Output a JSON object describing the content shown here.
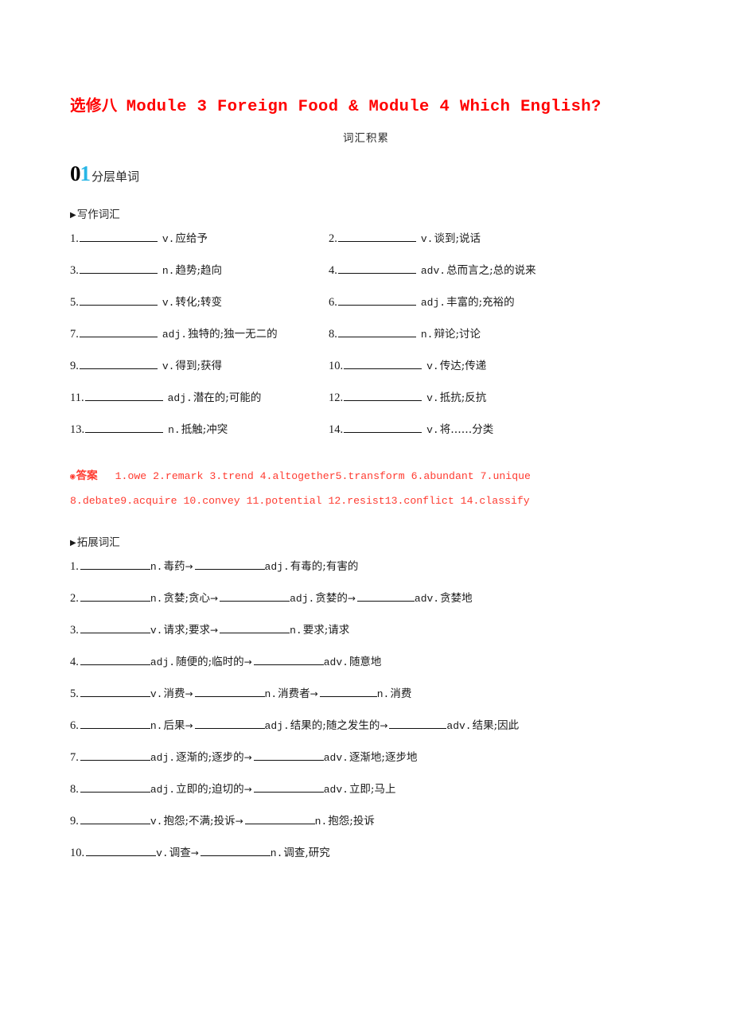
{
  "document": {
    "title_cn": "选修八",
    "title_en": "Module 3  Foreign Food & Module 4  Which English?",
    "subtitle": "词汇积累",
    "title_color": "#ff0000"
  },
  "section": {
    "number_first": "0",
    "number_second": "1",
    "label": "分层单词",
    "accent_color": "#29b6e6"
  },
  "writing_vocab": {
    "heading": "写作词汇",
    "marker": "triangle-right-icon",
    "items": [
      {
        "index": "1.",
        "pos": "v.",
        "meaning": "应给予"
      },
      {
        "index": "2.",
        "pos": "v.",
        "meaning": "谈到;说话"
      },
      {
        "index": "3.",
        "pos": "n.",
        "meaning": "趋势;趋向"
      },
      {
        "index": "4.",
        "pos": "adv.",
        "meaning": "总而言之;总的说来"
      },
      {
        "index": "5.",
        "pos": "v.",
        "meaning": "转化;转变"
      },
      {
        "index": "6.",
        "pos": "adj.",
        "meaning": "丰富的;充裕的"
      },
      {
        "index": "7.",
        "pos": "adj.",
        "meaning": "独特的;独一无二的"
      },
      {
        "index": "8.",
        "pos": "n.",
        "meaning": "辩论;讨论"
      },
      {
        "index": "9.",
        "pos": "v.",
        "meaning": "得到;获得"
      },
      {
        "index": "10.",
        "pos": "v.",
        "meaning": "传达;传递"
      },
      {
        "index": "11.",
        "pos": "adj.",
        "meaning": "潜在的;可能的"
      },
      {
        "index": "12.",
        "pos": "v.",
        "meaning": "抵抗;反抗"
      },
      {
        "index": "13.",
        "pos": "n.",
        "meaning": "抵触;冲突"
      },
      {
        "index": "14.",
        "pos": "v.",
        "meaning": "将……分类"
      }
    ]
  },
  "answer_key": {
    "label": "答案",
    "bullet": "filled-bullet-icon",
    "color": "#ff3b30",
    "line1": "1.owe  2.remark  3.trend  4.altogether5.transform   6.abundant  7.unique",
    "line2": "8.debate9.acquire  10.convey  11.potential  12.resist13.conflict  14.classify",
    "answers": [
      {
        "n": "1.",
        "word": "owe"
      },
      {
        "n": "2.",
        "word": "remark"
      },
      {
        "n": "3.",
        "word": "trend"
      },
      {
        "n": "4.",
        "word": "altogether"
      },
      {
        "n": "5.",
        "word": "transform"
      },
      {
        "n": "6.",
        "word": "abundant"
      },
      {
        "n": "7.",
        "word": "unique"
      },
      {
        "n": "8.",
        "word": "debate"
      },
      {
        "n": "9.",
        "word": "acquire"
      },
      {
        "n": "10.",
        "word": "convey"
      },
      {
        "n": "11.",
        "word": "potential"
      },
      {
        "n": "12.",
        "word": "resist"
      },
      {
        "n": "13.",
        "word": "conflict"
      },
      {
        "n": "14.",
        "word": "classify"
      }
    ]
  },
  "extended_vocab": {
    "heading": "拓展词汇",
    "marker": "triangle-right-icon",
    "items": [
      {
        "index": "1.",
        "parts": [
          {
            "pos": "n.",
            "meaning": "毒药"
          },
          {
            "pos": "adj.",
            "meaning": "有毒的;有害的"
          }
        ]
      },
      {
        "index": "2.",
        "parts": [
          {
            "pos": "n.",
            "meaning": "贪婪;贪心"
          },
          {
            "pos": "adj.",
            "meaning": "贪婪的"
          },
          {
            "pos": "adv.",
            "meaning": "贪婪地"
          }
        ]
      },
      {
        "index": "3.",
        "parts": [
          {
            "pos": "v.",
            "meaning": "请求;要求"
          },
          {
            "pos": "n.",
            "meaning": "要求;请求"
          }
        ]
      },
      {
        "index": "4.",
        "parts": [
          {
            "pos": "adj.",
            "meaning": "随便的;临时的"
          },
          {
            "pos": "adv.",
            "meaning": "随意地"
          }
        ]
      },
      {
        "index": "5.",
        "parts": [
          {
            "pos": "v.",
            "meaning": "消费"
          },
          {
            "pos": "n.",
            "meaning": "消费者"
          },
          {
            "pos": "n.",
            "meaning": "消费"
          }
        ]
      },
      {
        "index": "6.",
        "parts": [
          {
            "pos": "n.",
            "meaning": "后果"
          },
          {
            "pos": "adj.",
            "meaning": "结果的;随之发生的"
          },
          {
            "pos": "adv.",
            "meaning": "结果;因此"
          }
        ]
      },
      {
        "index": "7.",
        "parts": [
          {
            "pos": "adj.",
            "meaning": "逐渐的;逐步的"
          },
          {
            "pos": "adv.",
            "meaning": "逐渐地;逐步地"
          }
        ]
      },
      {
        "index": "8.",
        "parts": [
          {
            "pos": "adj.",
            "meaning": "立即的;迫切的"
          },
          {
            "pos": "adv.",
            "meaning": "立即;马上"
          }
        ]
      },
      {
        "index": "9.",
        "parts": [
          {
            "pos": "v.",
            "meaning": "抱怨;不满;投诉"
          },
          {
            "pos": "n.",
            "meaning": "抱怨;投诉"
          }
        ]
      },
      {
        "index": "10.",
        "parts": [
          {
            "pos": "v.",
            "meaning": "调查"
          },
          {
            "pos": "n.",
            "meaning": "调查,研究"
          }
        ]
      }
    ]
  }
}
